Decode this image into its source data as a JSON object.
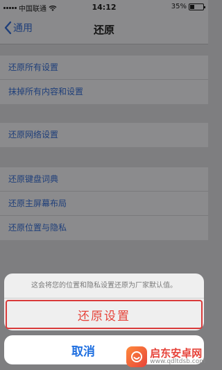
{
  "status_bar": {
    "carrier": "中国联通",
    "time": "14:12",
    "battery": "35%",
    "battery_level": 0.35
  },
  "nav": {
    "back_label": "通用",
    "title": "还原"
  },
  "groups": [
    {
      "items": [
        "还原所有设置",
        "抹掉所有内容和设置"
      ]
    },
    {
      "items": [
        "还原网络设置"
      ]
    },
    {
      "items": [
        "还原键盘词典",
        "还原主屏幕布局",
        "还原位置与隐私"
      ]
    }
  ],
  "action_sheet": {
    "message": "这会将您的位置和隐私设置还原为厂家默认值。",
    "confirm_label": "还原设置",
    "cancel_label": "取消"
  },
  "watermark": {
    "name": "启东安卓网",
    "url": "www.qdltdsb.com"
  },
  "colors": {
    "link": "#1f3f7a",
    "destructive": "#e6433a",
    "cancel": "#1f6fe0",
    "dim_background": "#7e7e80"
  }
}
